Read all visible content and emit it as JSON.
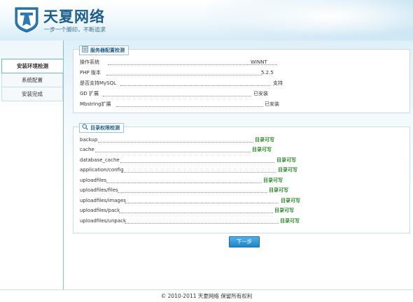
{
  "header": {
    "brand": "天夏网络",
    "slogan": "一步一个脚印，不断追求",
    "brand_color": "#1d5e8d"
  },
  "sidebar": {
    "items": [
      {
        "label": "安装环境检测",
        "active": true
      },
      {
        "label": "系统配置",
        "active": false
      },
      {
        "label": "安装完成",
        "active": false
      }
    ]
  },
  "server_check": {
    "title": "服务器配置检测",
    "rows": [
      {
        "label": "操作系统",
        "value": "WINNT"
      },
      {
        "label": "PHP 版本",
        "value": "5.2.5"
      },
      {
        "label": "是否支持MySQL",
        "value": "支持"
      },
      {
        "label": "GD 扩展",
        "value": "已安装"
      },
      {
        "label": "Mbstring扩展",
        "value": "已安装"
      }
    ]
  },
  "dir_check": {
    "title": "目录权限检测",
    "rows": [
      {
        "label": "backup",
        "value": "目录可写"
      },
      {
        "label": "cache",
        "value": "目录可写"
      },
      {
        "label": "database_cache",
        "value": "目录可写"
      },
      {
        "label": "application/config",
        "value": "目录可写"
      },
      {
        "label": "uploadfiles",
        "value": "目录可写"
      },
      {
        "label": "uploadfiles/files",
        "value": "目录可写"
      },
      {
        "label": "uploadfiles/images",
        "value": "目录可写"
      },
      {
        "label": "uploadfiles/pack",
        "value": "目录可写"
      },
      {
        "label": "uploadfiles/unpack",
        "value": "目录可写"
      }
    ],
    "ok_color": "#2e8b2e"
  },
  "next_button": "下一步",
  "footer": "© 2010-2011 天夏网络 保留所有权利"
}
